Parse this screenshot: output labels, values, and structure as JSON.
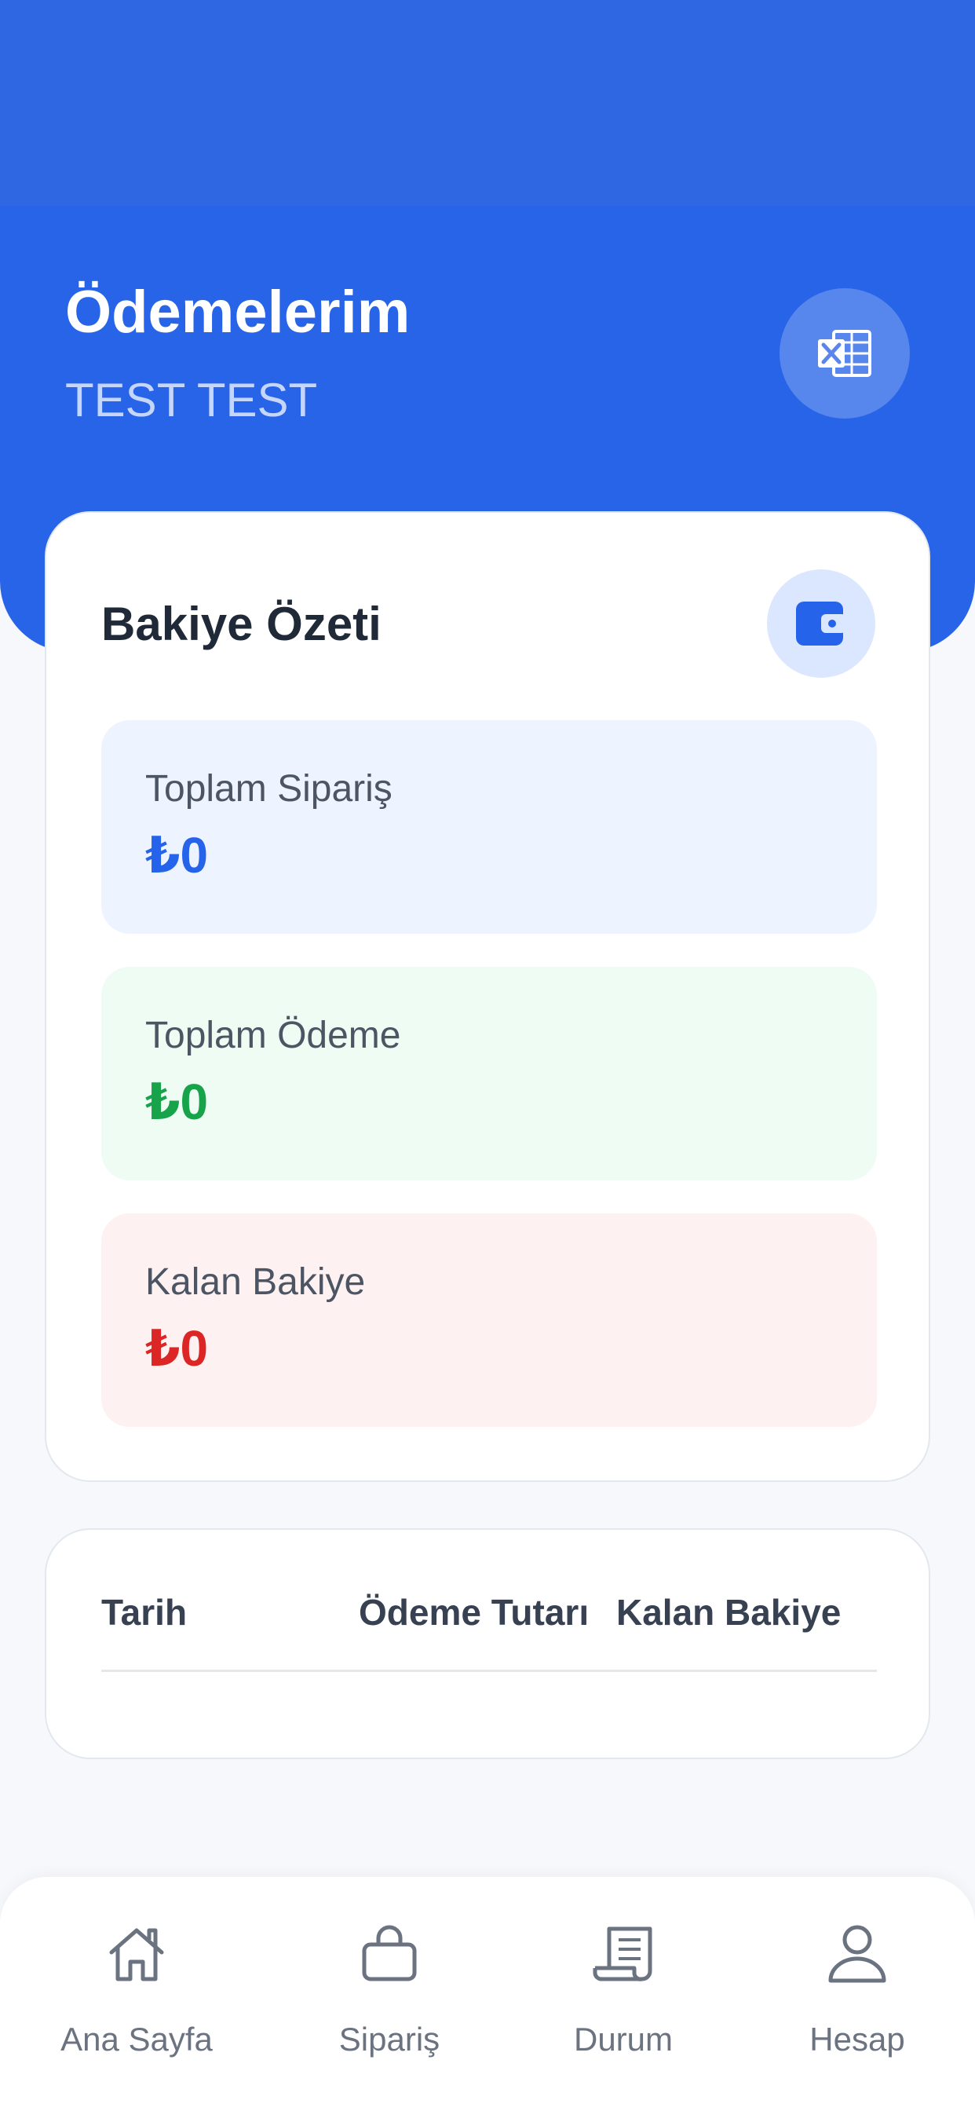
{
  "header": {
    "title": "Ödemelerim",
    "subtitle": "TEST TEST",
    "export_icon": "excel-icon"
  },
  "summary": {
    "title": "Bakiye Özeti",
    "icon": "wallet-icon",
    "stats": [
      {
        "label": "Toplam Sipariş",
        "value": "₺0",
        "color": "#2563eb",
        "background": "#eef4ff"
      },
      {
        "label": "Toplam Ödeme",
        "value": "₺0",
        "color": "#16a34a",
        "background": "#effcf4"
      },
      {
        "label": "Kalan Bakiye",
        "value": "₺0",
        "color": "#dc2626",
        "background": "#fef1f1"
      }
    ]
  },
  "table": {
    "columns": [
      "Tarih",
      "Ödeme Tutarı",
      "Kalan Bakiye"
    ],
    "rows": []
  },
  "nav": {
    "items": [
      {
        "label": "Ana Sayfa",
        "icon": "home-icon"
      },
      {
        "label": "Sipariş",
        "icon": "shopping-bag-icon"
      },
      {
        "label": "Durum",
        "icon": "receipt-icon"
      },
      {
        "label": "Hesap",
        "icon": "user-icon"
      }
    ]
  },
  "colors": {
    "primary": "#2864e8",
    "text_dark": "#1f2937",
    "text_muted": "#6b7280"
  }
}
